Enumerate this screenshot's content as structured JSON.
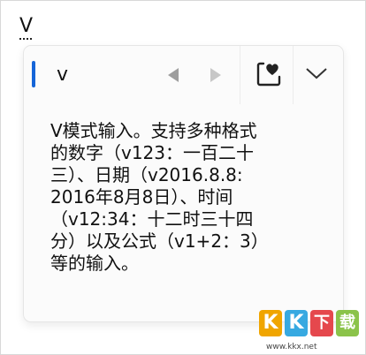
{
  "composition": {
    "typed_text": "V"
  },
  "candidate_panel": {
    "candidate": "v",
    "prev_page_icon": "triangle-left-icon",
    "next_page_icon": "triangle-right-icon",
    "favorite_icon": "heart-in-box-icon",
    "expand_icon": "chevron-down-icon",
    "accent_color": "#1565d8",
    "description": "V模式输入。支持多种格式\n的数字（v123：一百二十\n三）、日期（v2016.8.8:\n2016年8月8日）、时间\n（v12:34：十二时三十四\n分）以及公式（v1+2：3）\n等的输入。"
  },
  "watermark": {
    "logo_letters": [
      "K",
      "K",
      "下",
      "载"
    ],
    "logo_colors": [
      "#f0a500",
      "#37a9e1",
      "#e5484d",
      "#8bc34a"
    ],
    "url": "www.kkx.net"
  }
}
